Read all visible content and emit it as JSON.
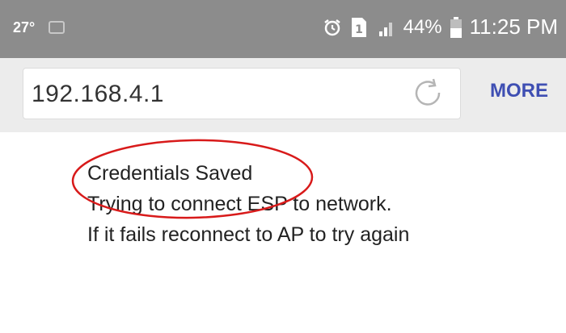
{
  "status_bar": {
    "temperature": "27°",
    "battery_percent": "44%",
    "time": "11:25 PM",
    "icons": [
      "image-icon",
      "alarm-icon",
      "sim-icon",
      "signal-icon",
      "battery-icon"
    ]
  },
  "browser": {
    "url": "192.168.4.1",
    "more_label": "MORE",
    "reload_icon": "reload-icon"
  },
  "page": {
    "lines": [
      "Credentials Saved",
      "Trying to connect ESP to network.",
      "If it fails reconnect to AP to try again"
    ]
  },
  "colors": {
    "status_bar": "#8c8c8c",
    "more_text": "#3f4fb3",
    "annotation": "#d81a1a"
  }
}
